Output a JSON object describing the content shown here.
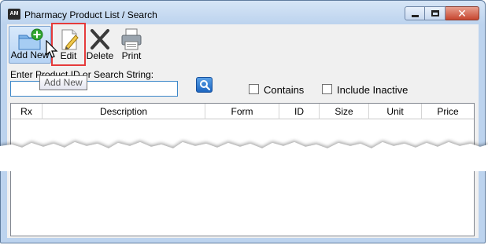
{
  "window": {
    "title": "Pharmacy Product List / Search",
    "app_icon_text": "AM"
  },
  "toolbar": {
    "add_label": "Add New",
    "edit_label": "Edit",
    "delete_label": "Delete",
    "print_label": "Print"
  },
  "search": {
    "label": "Enter Product ID or Search String:",
    "value": ""
  },
  "options": {
    "contains_label": "Contains",
    "include_inactive_label": "Include Inactive",
    "contains_checked": false,
    "include_inactive_checked": false
  },
  "grid": {
    "columns": [
      "Rx",
      "Description",
      "Form",
      "ID",
      "Size",
      "Unit",
      "Price"
    ]
  },
  "tooltip": {
    "text": "Add New"
  },
  "colors": {
    "highlight": "#e53a3a",
    "accent": "#1c65c0"
  }
}
